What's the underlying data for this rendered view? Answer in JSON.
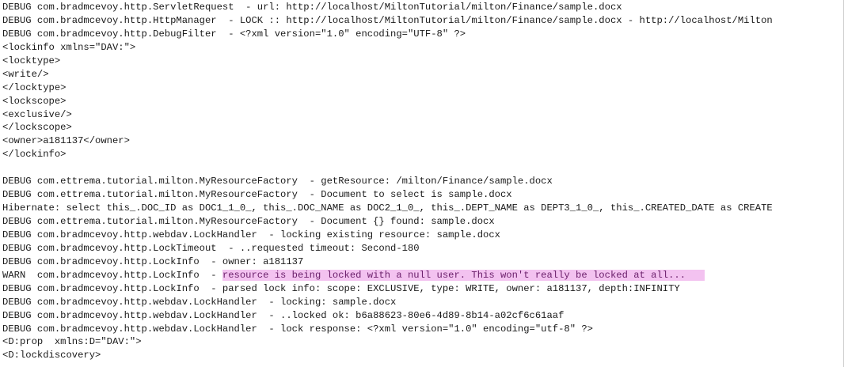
{
  "log": {
    "lines": [
      "DEBUG com.bradmcevoy.http.ServletRequest  - url: http://localhost/MiltonTutorial/milton/Finance/sample.docx",
      "DEBUG com.bradmcevoy.http.HttpManager  - LOCK :: http://localhost/MiltonTutorial/milton/Finance/sample.docx - http://localhost/Milton",
      "DEBUG com.bradmcevoy.http.DebugFilter  - <?xml version=\"1.0\" encoding=\"UTF-8\" ?>",
      "<lockinfo xmlns=\"DAV:\">",
      "<locktype>",
      "<write/>",
      "</locktype>",
      "<lockscope>",
      "<exclusive/>",
      "</lockscope>",
      "<owner>a181137</owner>",
      "</lockinfo>",
      "",
      "DEBUG com.ettrema.tutorial.milton.MyResourceFactory  - getResource: /milton/Finance/sample.docx",
      "DEBUG com.ettrema.tutorial.milton.MyResourceFactory  - Document to select is sample.docx",
      "Hibernate: select this_.DOC_ID as DOC1_1_0_, this_.DOC_NAME as DOC2_1_0_, this_.DEPT_NAME as DEPT3_1_0_, this_.CREATED_DATE as CREATE",
      "DEBUG com.ettrema.tutorial.milton.MyResourceFactory  - Document {} found: sample.docx",
      "DEBUG com.bradmcevoy.http.webdav.LockHandler  - locking existing resource: sample.docx",
      "DEBUG com.bradmcevoy.http.LockTimeout  - ..requested timeout: Second-180",
      "DEBUG com.bradmcevoy.http.LockInfo  - owner: a181137",
      "WARN  com.bradmcevoy.http.LockInfo  - ",
      "DEBUG com.bradmcevoy.http.LockInfo  - parsed lock info: scope: EXCLUSIVE, type: WRITE, owner: a181137, depth:INFINITY",
      "DEBUG com.bradmcevoy.http.webdav.LockHandler  - locking: sample.docx",
      "DEBUG com.bradmcevoy.http.webdav.LockHandler  - ..locked ok: b6a88623-80e6-4d89-8b14-a02cf6c61aaf",
      "DEBUG com.bradmcevoy.http.webdav.LockHandler  - lock response: <?xml version=\"1.0\" encoding=\"utf-8\" ?>",
      "<D:prop  xmlns:D=\"DAV:\">",
      "<D:lockdiscovery>"
    ],
    "warn_message": "resource is being locked with a null user. This won't really be locked at all...",
    "highlight_color": "#f3c2f0"
  }
}
